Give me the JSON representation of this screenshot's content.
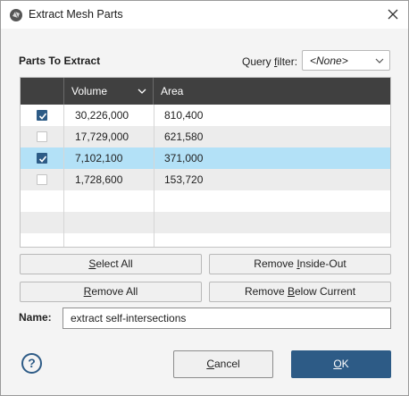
{
  "window": {
    "title": "Extract Mesh Parts"
  },
  "parts": {
    "heading": "Parts To Extract",
    "query_filter_label": "Query filter:",
    "query_filter_value": "<None>"
  },
  "table": {
    "columns": [
      "",
      "Volume",
      "Area"
    ],
    "rows": [
      {
        "checked": true,
        "volume": "30,226,000",
        "area": "810,400",
        "selected": false
      },
      {
        "checked": false,
        "volume": "17,729,000",
        "area": "621,580",
        "selected": false
      },
      {
        "checked": true,
        "volume": "7,102,100",
        "area": "371,000",
        "selected": true
      },
      {
        "checked": false,
        "volume": "1,728,600",
        "area": "153,720",
        "selected": false
      }
    ]
  },
  "buttons": {
    "select_all": "Select All",
    "remove_inside_out": "Remove Inside-Out",
    "remove_all": "Remove All",
    "remove_below_current": "Remove Below Current",
    "cancel": "Cancel",
    "ok": "OK",
    "help": "?"
  },
  "name": {
    "label": "Name:",
    "value": "extract self-intersections"
  },
  "colors": {
    "accent": "#2d5b86",
    "header": "#404040",
    "selected_row": "#b3e1f7",
    "zebra": "#ececec"
  }
}
